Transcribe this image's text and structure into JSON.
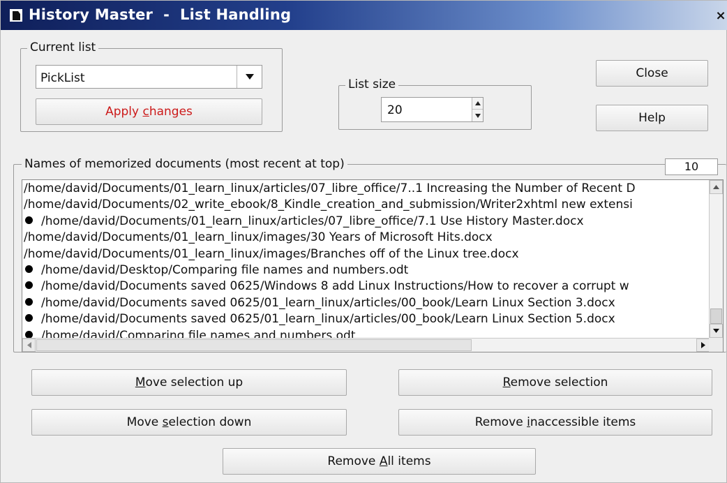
{
  "window": {
    "title": "History Master  -  List Handling",
    "close_glyph": "×"
  },
  "current_list": {
    "label": "Current list",
    "selected": "PickList",
    "apply_before": "Apply ",
    "apply_mnemonic": "c",
    "apply_after": "hanges"
  },
  "list_size": {
    "label": "List size",
    "value": "20"
  },
  "buttons": {
    "close": "Close",
    "help": "Help",
    "move_up_mnemonic": "M",
    "move_up_rest": "ove selection up",
    "move_down_before": "Move ",
    "move_down_mnemonic": "s",
    "move_down_rest": "election down",
    "remove_sel_mnemonic": "R",
    "remove_sel_rest": "emove selection",
    "remove_inacc_before": "Remove ",
    "remove_inacc_mnemonic": "i",
    "remove_inacc_rest": "naccessible items",
    "remove_all_before": "Remove ",
    "remove_all_mnemonic": "A",
    "remove_all_rest": "ll items"
  },
  "documents": {
    "label": "Names of memorized documents (most recent at top)",
    "count": "10",
    "items": [
      {
        "bullet": false,
        "path": "/home/david/Documents/01_learn_linux/articles/07_libre_office/7..1 Increasing the Number of Recent D"
      },
      {
        "bullet": false,
        "path": "/home/david/Documents/02_write_ebook/8_Kindle_creation_and_submission/Writer2xhtml new extensi"
      },
      {
        "bullet": true,
        "path": "/home/david/Documents/01_learn_linux/articles/07_libre_office/7.1 Use History Master.docx"
      },
      {
        "bullet": false,
        "path": "/home/david/Documents/01_learn_linux/images/30 Years of Microsoft Hits.docx"
      },
      {
        "bullet": false,
        "path": "/home/david/Documents/01_learn_linux/images/Branches off of the Linux tree.docx"
      },
      {
        "bullet": true,
        "path": "/home/david/Desktop/Comparing file names and numbers.odt"
      },
      {
        "bullet": true,
        "path": "/home/david/Documents saved 0625/Windows 8 add Linux Instructions/How to recover a corrupt w"
      },
      {
        "bullet": true,
        "path": "/home/david/Documents saved 0625/01_learn_linux/articles/00_book/Learn Linux Section 3.docx"
      },
      {
        "bullet": true,
        "path": "/home/david/Documents saved 0625/01_learn_linux/articles/00_book/Learn Linux Section 5.docx"
      },
      {
        "bullet": true,
        "path": "/home/david/Comparing file names and numbers.odt"
      }
    ]
  },
  "icons": {
    "title": "window-icon",
    "combo": "chevron-down-icon",
    "spin_up": "arrow-up-icon",
    "spin_down": "arrow-down-icon",
    "bullet": "bullet-icon"
  },
  "colors": {
    "apply_text": "#cc1a1a",
    "title_bar": "#23408c"
  }
}
